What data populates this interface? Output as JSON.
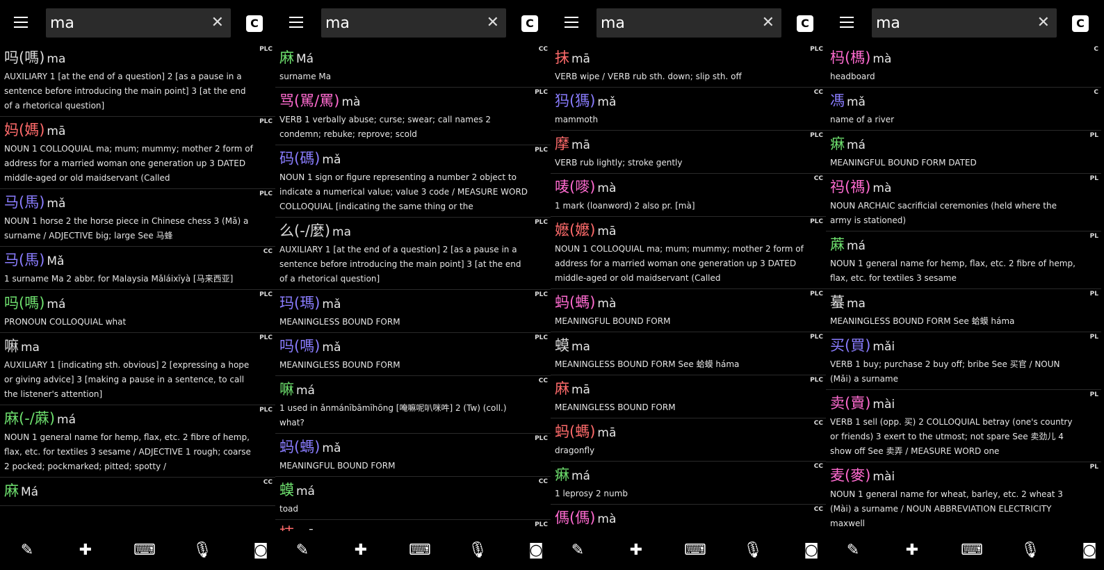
{
  "panels": [
    {
      "search": {
        "value": "ma"
      },
      "c_label": "C",
      "entries": [
        {
          "hz": "吗(嗎)",
          "py": "ma",
          "color": "#d9d9d9",
          "src": "PLC",
          "def": "AUXILIARY 1 [at the end of a question] 2 [as a pause in a sentence before introducing the main point] 3 [at the end of a rhetorical question]"
        },
        {
          "hz": "妈(媽)",
          "py": "mā",
          "color": "#ff6b6b",
          "src": "PLC",
          "def": "NOUN 1 COLLOQUIAL ma; mum; mummy; mother 2 form of address for a married woman one generation up 3 DATED middle-aged or old maidservant (Called"
        },
        {
          "hz": "马(馬)",
          "py": "mǎ",
          "color": "#8a7dff",
          "src": "PLC",
          "def": "NOUN 1 horse 2 the horse piece in Chinese chess 3 (Mǎ) a surname / ADJECTIVE big; large See 马蜂"
        },
        {
          "hz": "马(馬)",
          "py": "Mǎ",
          "color": "#8a7dff",
          "src": "CC",
          "def": "1 surname Ma 2 abbr. for Malaysia Mǎláixīyà [马来西亚]"
        },
        {
          "hz": "吗(嗎)",
          "py": "má",
          "color": "#6ee06e",
          "src": "PLC",
          "def": "PRONOUN COLLOQUIAL what"
        },
        {
          "hz": "嘛",
          "py": "ma",
          "color": "#d9d9d9",
          "src": "PLC",
          "def": "AUXILIARY 1 [indicating sth. obvious] 2 [expressing a hope or giving advice] 3 [making a pause in a sentence, to call the listener's attention]"
        },
        {
          "hz": "麻(-/蔴)",
          "py": "má",
          "color": "#6ee06e",
          "src": "PLC",
          "def": "NOUN 1 general name for hemp, flax, etc. 2 fibre of hemp, flax, etc. for textiles 3 sesame / ADJECTIVE 1 rough; coarse 2 pocked; pockmarked; pitted; spotty /"
        },
        {
          "hz": "麻",
          "py": "Má",
          "color": "#6ee06e",
          "src": "CC",
          "def": ""
        }
      ],
      "bottom_icons": [
        "brush-icon",
        "puzzle-icon",
        "keyboard-icon",
        "mic-icon",
        "camera-icon"
      ]
    },
    {
      "search": {
        "value": "ma"
      },
      "c_label": "C",
      "entries": [
        {
          "hz": "麻",
          "py": "Má",
          "color": "#6ee06e",
          "src": "CC",
          "def": "surname Ma"
        },
        {
          "hz": "骂(駡/罵)",
          "py": "mà",
          "color": "#ff6bd0",
          "src": "PLC",
          "def": "VERB 1 verbally abuse; curse; swear; call names 2 condemn; rebuke; reprove; scold"
        },
        {
          "hz": "码(碼)",
          "py": "mǎ",
          "color": "#8a7dff",
          "src": "PLC",
          "def": "NOUN 1 sign or figure representing a number 2 object to indicate a numerical value; value 3 code / MEASURE WORD COLLOQUIAL [indicating the same thing or the"
        },
        {
          "hz": "么(-/麼)",
          "py": "ma",
          "color": "#d9d9d9",
          "src": "PLC",
          "def": "AUXILIARY 1 [at the end of a question] 2 [as a pause in a sentence before introducing the main point] 3 [at the end of a rhetorical question]"
        },
        {
          "hz": "玛(瑪)",
          "py": "mǎ",
          "color": "#8a7dff",
          "src": "PLC",
          "def": "MEANINGLESS BOUND FORM"
        },
        {
          "hz": "吗(嗎)",
          "py": "mǎ",
          "color": "#8a7dff",
          "src": "PLC",
          "def": "MEANINGLESS BOUND FORM"
        },
        {
          "hz": "嘛",
          "py": "má",
          "color": "#6ee06e",
          "src": "CC",
          "def": "1 used in ǎnmánībāmīhōng [唵嘛呢叭咪吽] 2 (Tw) (coll.) what?"
        },
        {
          "hz": "蚂(螞)",
          "py": "mǎ",
          "color": "#8a7dff",
          "src": "PLC",
          "def": "MEANINGFUL BOUND FORM"
        },
        {
          "hz": "蟆",
          "py": "má",
          "color": "#6ee06e",
          "src": "CC",
          "def": "toad"
        },
        {
          "hz": "抹",
          "py": "mā",
          "color": "#ff6b6b",
          "src": "PLC",
          "def": ""
        }
      ],
      "bottom_icons": [
        "brush-icon",
        "puzzle-icon",
        "keyboard-icon",
        "mic-icon",
        "camera-icon"
      ]
    },
    {
      "search": {
        "value": "ma"
      },
      "c_label": "C",
      "entries": [
        {
          "hz": "抹",
          "py": "mā",
          "color": "#ff6b6b",
          "src": "PLC",
          "def": "VERB wipe / VERB rub sth. down; slip sth. off"
        },
        {
          "hz": "犸(獁)",
          "py": "mǎ",
          "color": "#8a7dff",
          "src": "CC",
          "def": "mammoth"
        },
        {
          "hz": "摩",
          "py": "mā",
          "color": "#ff6b6b",
          "src": "PLC",
          "def": "VERB rub lightly; stroke gently"
        },
        {
          "hz": "唛(嘜)",
          "py": "mà",
          "color": "#ff6bd0",
          "src": "CC",
          "def": "1 mark (loanword) 2 also pr. [mà]"
        },
        {
          "hz": "嬷(嬤)",
          "py": "mā",
          "color": "#ff6b6b",
          "src": "PLC",
          "def": "NOUN 1 COLLOQUIAL ma; mum; mummy; mother 2 form of address for a married woman one generation up 3 DATED middle-aged or old maidservant (Called"
        },
        {
          "hz": "蚂(螞)",
          "py": "mà",
          "color": "#ff6bd0",
          "src": "PLC",
          "def": "MEANINGFUL BOUND FORM"
        },
        {
          "hz": "蟆",
          "py": "ma",
          "color": "#d9d9d9",
          "src": "PLC",
          "def": "MEANINGLESS BOUND FORM See 蛤蟆 háma"
        },
        {
          "hz": "麻",
          "py": "mā",
          "color": "#ff6b6b",
          "src": "PLC",
          "def": "MEANINGLESS BOUND FORM"
        },
        {
          "hz": "蚂(螞)",
          "py": "mā",
          "color": "#ff6b6b",
          "src": "CC",
          "def": "dragonfly"
        },
        {
          "hz": "痳",
          "py": "má",
          "color": "#6ee06e",
          "src": "CC",
          "def": "1 leprosy 2 numb"
        },
        {
          "hz": "傌(傌)",
          "py": "mà",
          "color": "#ff6bd0",
          "src": "CC",
          "def": ""
        }
      ],
      "bottom_icons": [
        "brush-icon",
        "puzzle-icon",
        "keyboard-icon",
        "mic-icon",
        "camera-icon"
      ]
    },
    {
      "search": {
        "value": "ma"
      },
      "c_label": "C",
      "entries": [
        {
          "hz": "杩(榪)",
          "py": "mà",
          "color": "#ff6bd0",
          "src": "C",
          "def": "headboard"
        },
        {
          "hz": "馮",
          "py": "mǎ",
          "color": "#8a7dff",
          "src": "C",
          "def": "name of a river"
        },
        {
          "hz": "痳",
          "py": "má",
          "color": "#6ee06e",
          "src": "PL",
          "def": "MEANINGFUL BOUND FORM DATED"
        },
        {
          "hz": "祃(禡)",
          "py": "mà",
          "color": "#ff6bd0",
          "src": "PL",
          "def": "NOUN ARCHAIC sacrificial ceremonies (held where the army is stationed)"
        },
        {
          "hz": "蔴",
          "py": "má",
          "color": "#6ee06e",
          "src": "PL",
          "def": "NOUN 1 general name for hemp, flax, etc. 2 fibre of hemp, flax, etc. for textiles 3 sesame"
        },
        {
          "hz": "蟇",
          "py": "ma",
          "color": "#d9d9d9",
          "src": "PL",
          "def": "MEANINGLESS BOUND FORM See 蛤蟆 háma"
        },
        {
          "hz": "买(買)",
          "py": "mǎi",
          "color": "#8a7dff",
          "src": "PL",
          "def": "VERB 1 buy; purchase 2 buy off; bribe See 买官 / NOUN (Mǎi) a surname"
        },
        {
          "hz": "卖(賣)",
          "py": "mài",
          "color": "#ff6bd0",
          "src": "PL",
          "def": "VERB 1 sell (opp. 买) 2 COLLOQUIAL betray (one's country or friends) 3 exert to the utmost; not spare See 卖劲儿 4 show off See 卖弄 / MEASURE WORD one"
        },
        {
          "hz": "麦(麥)",
          "py": "mài",
          "color": "#ff6bd0",
          "src": "PL",
          "def": "NOUN 1 general name for wheat, barley, etc. 2 wheat 3 (Mài) a surname / NOUN ABBREVIATION ELECTRICITY maxwell"
        }
      ],
      "bottom_icons": [
        "brush-icon",
        "puzzle-icon",
        "keyboard-icon",
        "mic-icon",
        "camera-icon"
      ]
    }
  ]
}
